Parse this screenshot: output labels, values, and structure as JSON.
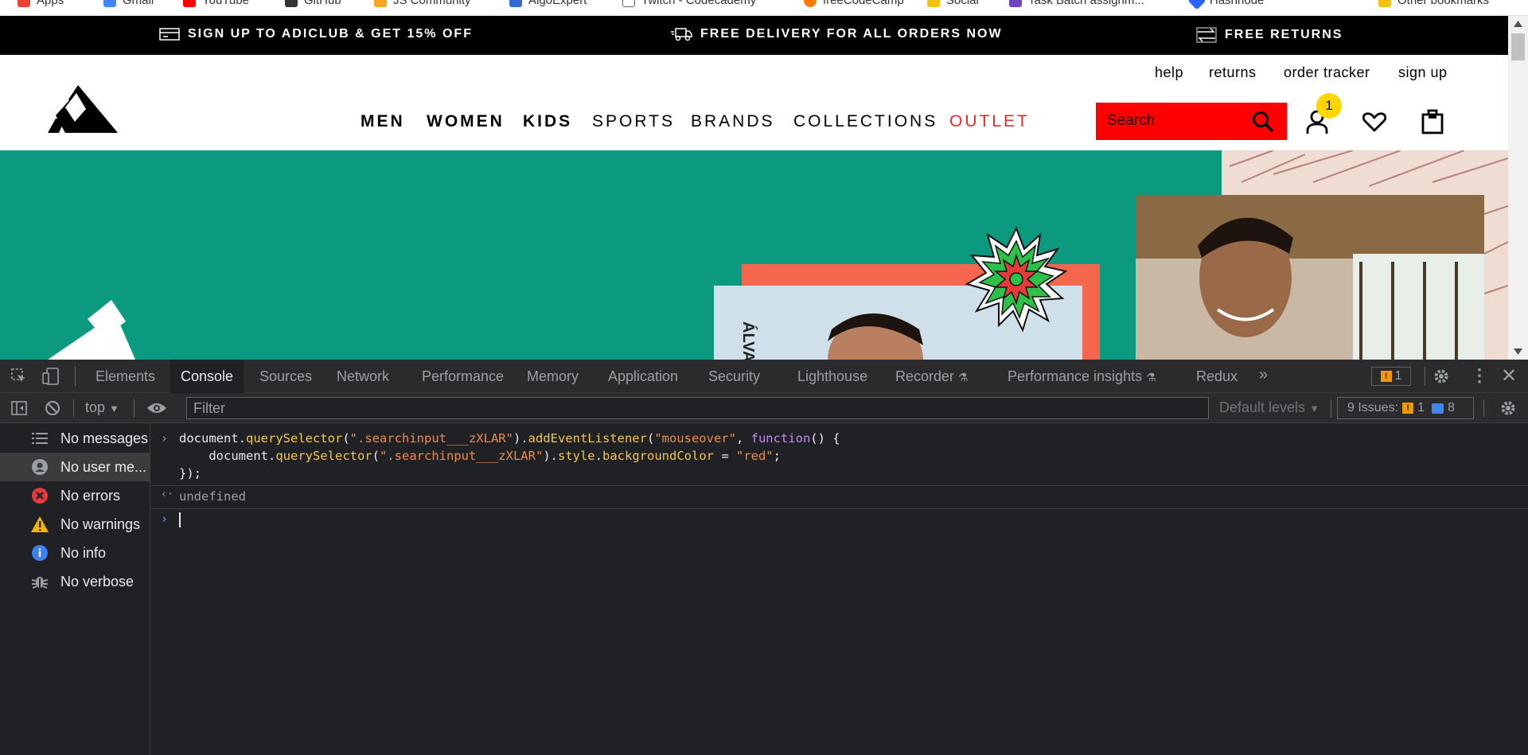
{
  "bookmarks": [
    {
      "label": "Apps",
      "color": "#ea4335"
    },
    {
      "label": "Gmail",
      "color": "#4285f4"
    },
    {
      "label": "YouTube",
      "color": "#ff0000"
    },
    {
      "label": "GitHub",
      "color": "#333333"
    },
    {
      "label": "JS Community",
      "color": "#f6a623"
    },
    {
      "label": "AlgoExpert",
      "color": "#3367d6"
    },
    {
      "label": "Twitch - Codecademy",
      "color": "#666666"
    },
    {
      "label": "freeCodeCamp",
      "color": "#ff7a00"
    },
    {
      "label": "Social",
      "color": "#f4c20d"
    },
    {
      "label": "Task Batch assignm...",
      "color": "#6f42c1"
    },
    {
      "label": "Hashnode",
      "color": "#2962ff"
    },
    {
      "label": "Other bookmarks",
      "color": "#f4c20d"
    }
  ],
  "promo": {
    "adiclub": "SIGN UP TO ADICLUB & GET 15% OFF",
    "delivery": "FREE DELIVERY FOR ALL ORDERS NOW",
    "returns": "FREE RETURNS"
  },
  "utility_nav": {
    "help": "help",
    "returns": "returns",
    "order_tracker": "order tracker",
    "sign_up": "sign up"
  },
  "main_nav": {
    "men": "MEN",
    "women": "WOMEN",
    "kids": "KIDS",
    "sports": "SPORTS",
    "brands": "BRANDS",
    "collections": "COLLECTIONS",
    "outlet": "OUTLET"
  },
  "search": {
    "placeholder": "Search",
    "background": "#ff0000"
  },
  "account_badge": "1",
  "hero": {
    "card_name": "ÁLVAREZ",
    "background": "#0b9a80"
  },
  "devtools": {
    "tabs": [
      "Elements",
      "Console",
      "Sources",
      "Network",
      "Performance",
      "Memory",
      "Application",
      "Security",
      "Lighthouse",
      "Recorder",
      "Performance insights",
      "Redux"
    ],
    "active_tab": "Console",
    "warning_count": "1",
    "context": "top",
    "filter_placeholder": "Filter",
    "levels": "Default levels",
    "issues_label": "9 Issues:",
    "issues_warn": "1",
    "issues_info": "8"
  },
  "sidebar": {
    "messages": "No messages",
    "user_messages": "No user me...",
    "errors": "No errors",
    "warnings": "No warnings",
    "info": "No info",
    "verbose": "No verbose"
  },
  "console": {
    "result": "undefined",
    "selector": "\".searchinput___zXLAR\"",
    "event": "\"mouseover\"",
    "value": "\"red\""
  }
}
